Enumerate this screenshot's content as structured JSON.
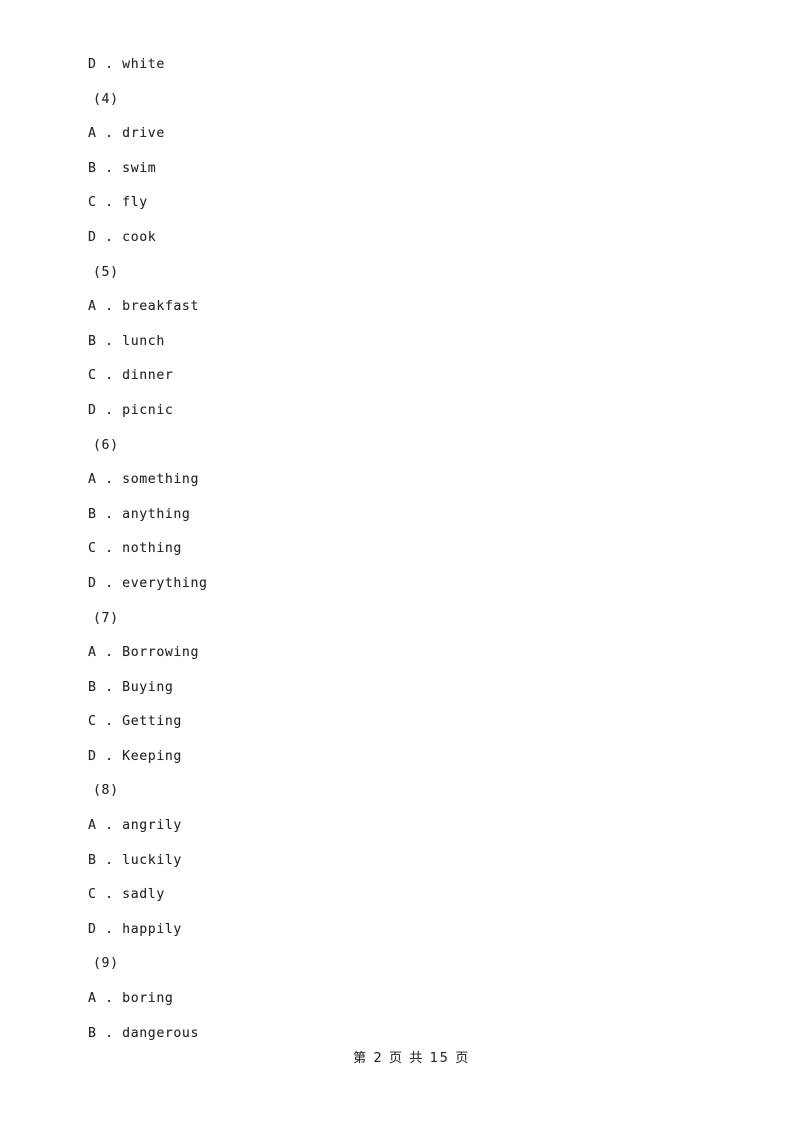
{
  "document": {
    "page_background": "#ffffff",
    "text_color": "#262626"
  },
  "footer": {
    "page_indicator": "第 2 页 共 15 页"
  },
  "body_lines": [
    {
      "kind": "option",
      "letter": "D",
      "separator": ".",
      "text": "white",
      "full": "D . white"
    },
    {
      "kind": "question",
      "number": "(4)",
      "full": "(4)"
    },
    {
      "kind": "option",
      "letter": "A",
      "separator": ".",
      "text": "drive",
      "full": "A . drive"
    },
    {
      "kind": "option",
      "letter": "B",
      "separator": ".",
      "text": "swim",
      "full": "B . swim"
    },
    {
      "kind": "option",
      "letter": "C",
      "separator": ".",
      "text": "fly",
      "full": "C . fly"
    },
    {
      "kind": "option",
      "letter": "D",
      "separator": ".",
      "text": "cook",
      "full": "D . cook"
    },
    {
      "kind": "question",
      "number": "(5)",
      "full": "(5)"
    },
    {
      "kind": "option",
      "letter": "A",
      "separator": ".",
      "text": "breakfast",
      "full": "A . breakfast"
    },
    {
      "kind": "option",
      "letter": "B",
      "separator": ".",
      "text": "lunch",
      "full": "B . lunch"
    },
    {
      "kind": "option",
      "letter": "C",
      "separator": ".",
      "text": "dinner",
      "full": "C . dinner"
    },
    {
      "kind": "option",
      "letter": "D",
      "separator": ".",
      "text": "picnic",
      "full": "D . picnic"
    },
    {
      "kind": "question",
      "number": "(6)",
      "full": "(6)"
    },
    {
      "kind": "option",
      "letter": "A",
      "separator": ".",
      "text": "something",
      "full": "A . something"
    },
    {
      "kind": "option",
      "letter": "B",
      "separator": ".",
      "text": "anything",
      "full": "B . anything"
    },
    {
      "kind": "option",
      "letter": "C",
      "separator": ".",
      "text": "nothing",
      "full": "C . nothing"
    },
    {
      "kind": "option",
      "letter": "D",
      "separator": ".",
      "text": "everything",
      "full": "D . everything"
    },
    {
      "kind": "question",
      "number": "(7)",
      "full": "(7)"
    },
    {
      "kind": "option",
      "letter": "A",
      "separator": ".",
      "text": "Borrowing",
      "full": "A . Borrowing"
    },
    {
      "kind": "option",
      "letter": "B",
      "separator": ".",
      "text": "Buying",
      "full": "B . Buying"
    },
    {
      "kind": "option",
      "letter": "C",
      "separator": ".",
      "text": "Getting",
      "full": "C . Getting"
    },
    {
      "kind": "option",
      "letter": "D",
      "separator": ".",
      "text": "Keeping",
      "full": "D . Keeping"
    },
    {
      "kind": "question",
      "number": "(8)",
      "full": "(8)"
    },
    {
      "kind": "option",
      "letter": "A",
      "separator": ".",
      "text": "angrily",
      "full": "A . angrily"
    },
    {
      "kind": "option",
      "letter": "B",
      "separator": ".",
      "text": "luckily",
      "full": "B . luckily"
    },
    {
      "kind": "option",
      "letter": "C",
      "separator": ".",
      "text": "sadly",
      "full": "C . sadly"
    },
    {
      "kind": "option",
      "letter": "D",
      "separator": ".",
      "text": "happily",
      "full": "D . happily"
    },
    {
      "kind": "question",
      "number": "(9)",
      "full": "(9)"
    },
    {
      "kind": "option",
      "letter": "A",
      "separator": ".",
      "text": "boring",
      "full": "A . boring"
    },
    {
      "kind": "option",
      "letter": "B",
      "separator": ".",
      "text": "dangerous",
      "full": "B . dangerous"
    }
  ]
}
